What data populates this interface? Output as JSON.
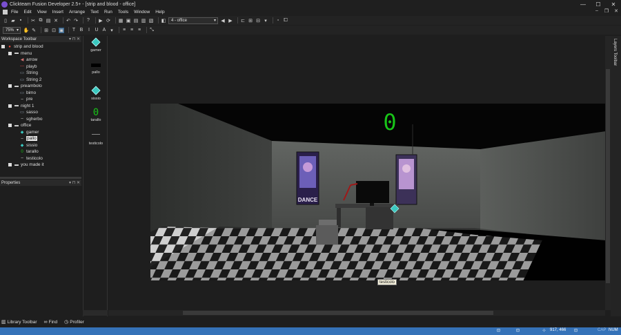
{
  "window": {
    "title": "Clickteam Fusion Developer 2.5+ - [strip and blood - office]",
    "minimize": "—",
    "maximize": "☐",
    "close": "✕"
  },
  "menu": {
    "items": [
      "File",
      "Edit",
      "View",
      "Insert",
      "Arrange",
      "Text",
      "Run",
      "Tools",
      "Window",
      "Help"
    ]
  },
  "toolbar": {
    "frame_select": "4 - office",
    "zoom": "75%"
  },
  "workspace": {
    "title": "Workspace Toolbar",
    "tree": [
      {
        "label": "strip and blood",
        "level": 0,
        "icon": "app-icon"
      },
      {
        "label": "menu",
        "level": 1,
        "icon": "frame-icon"
      },
      {
        "label": "arrow",
        "level": 2,
        "icon": "arrow-icon"
      },
      {
        "label": "playb",
        "level": 2,
        "icon": "line-icon"
      },
      {
        "label": "String",
        "level": 2,
        "icon": "string-icon"
      },
      {
        "label": "String 2",
        "level": 2,
        "icon": "string-icon"
      },
      {
        "label": "preambolo",
        "level": 1,
        "icon": "frame-icon"
      },
      {
        "label": "bimo",
        "level": 2,
        "icon": "string-icon"
      },
      {
        "label": "pre",
        "level": 2,
        "icon": "line-icon"
      },
      {
        "label": "night 1",
        "level": 1,
        "icon": "frame-icon"
      },
      {
        "label": "sasso",
        "level": 2,
        "icon": "string-icon"
      },
      {
        "label": "sgherbo",
        "level": 2,
        "icon": "line-icon"
      },
      {
        "label": "office",
        "level": 1,
        "icon": "frame-icon"
      },
      {
        "label": "gamer",
        "level": 2,
        "icon": "diamond-icon"
      },
      {
        "label": "pallo",
        "level": 2,
        "icon": "line-icon",
        "selected": true
      },
      {
        "label": "sissio",
        "level": 2,
        "icon": "diamond-icon"
      },
      {
        "label": "tarallo",
        "level": 2,
        "icon": "counter-icon"
      },
      {
        "label": "testicolo",
        "level": 2,
        "icon": "line-icon"
      },
      {
        "label": "you made it",
        "level": 1,
        "icon": "frame-icon"
      }
    ]
  },
  "properties": {
    "title": "Properties"
  },
  "shelf": {
    "items": [
      {
        "label": "gamer",
        "icon": "diamond-icon"
      },
      {
        "label": "pallo",
        "icon": "black-bar-icon"
      },
      {
        "label": "sissio",
        "icon": "diamond-icon"
      },
      {
        "label": "tarallo",
        "icon": "counter-icon",
        "glyph": "0"
      },
      {
        "label": "testicolo",
        "icon": "line-icon"
      }
    ]
  },
  "scene": {
    "counter_value": "0",
    "poster_text": "DANCE",
    "tooltip": "testicolo"
  },
  "layers": {
    "title": "Layers Toolbar"
  },
  "bottom_tabs": [
    {
      "label": "Library Toolbar",
      "icon": "library-icon"
    },
    {
      "label": "Find",
      "icon": "binoculars-icon"
    },
    {
      "label": "Profiler",
      "icon": "clock-icon"
    }
  ],
  "status": {
    "coords": "917, 466",
    "caps": "CAP",
    "num": "NUM"
  },
  "colors": {
    "accent": "#3572b8",
    "counter_green": "#18c418",
    "diamond": "#3bc9c0"
  }
}
